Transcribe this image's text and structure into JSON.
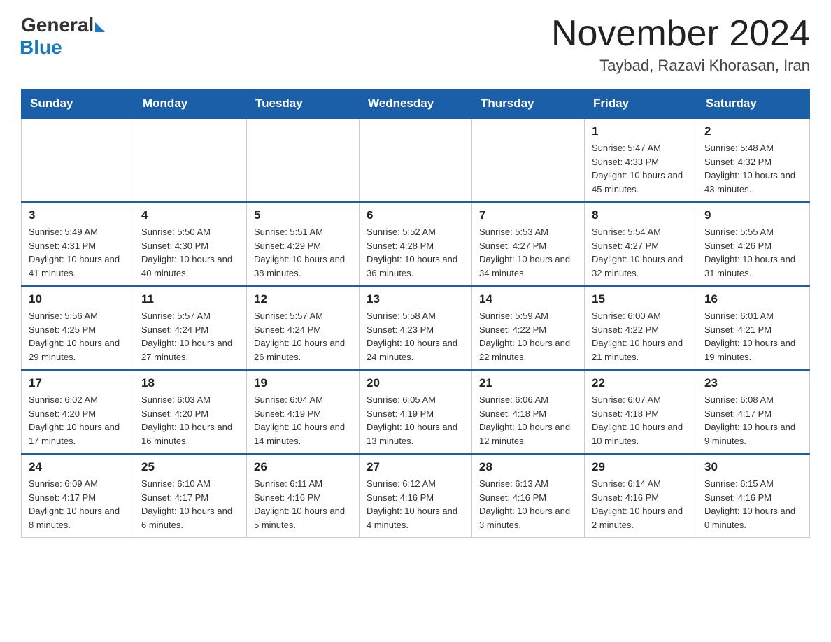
{
  "logo": {
    "general": "General",
    "blue": "Blue"
  },
  "title": "November 2024",
  "subtitle": "Taybad, Razavi Khorasan, Iran",
  "days_of_week": [
    "Sunday",
    "Monday",
    "Tuesday",
    "Wednesday",
    "Thursday",
    "Friday",
    "Saturday"
  ],
  "weeks": [
    [
      {
        "day": "",
        "info": ""
      },
      {
        "day": "",
        "info": ""
      },
      {
        "day": "",
        "info": ""
      },
      {
        "day": "",
        "info": ""
      },
      {
        "day": "",
        "info": ""
      },
      {
        "day": "1",
        "info": "Sunrise: 5:47 AM\nSunset: 4:33 PM\nDaylight: 10 hours and 45 minutes."
      },
      {
        "day": "2",
        "info": "Sunrise: 5:48 AM\nSunset: 4:32 PM\nDaylight: 10 hours and 43 minutes."
      }
    ],
    [
      {
        "day": "3",
        "info": "Sunrise: 5:49 AM\nSunset: 4:31 PM\nDaylight: 10 hours and 41 minutes."
      },
      {
        "day": "4",
        "info": "Sunrise: 5:50 AM\nSunset: 4:30 PM\nDaylight: 10 hours and 40 minutes."
      },
      {
        "day": "5",
        "info": "Sunrise: 5:51 AM\nSunset: 4:29 PM\nDaylight: 10 hours and 38 minutes."
      },
      {
        "day": "6",
        "info": "Sunrise: 5:52 AM\nSunset: 4:28 PM\nDaylight: 10 hours and 36 minutes."
      },
      {
        "day": "7",
        "info": "Sunrise: 5:53 AM\nSunset: 4:27 PM\nDaylight: 10 hours and 34 minutes."
      },
      {
        "day": "8",
        "info": "Sunrise: 5:54 AM\nSunset: 4:27 PM\nDaylight: 10 hours and 32 minutes."
      },
      {
        "day": "9",
        "info": "Sunrise: 5:55 AM\nSunset: 4:26 PM\nDaylight: 10 hours and 31 minutes."
      }
    ],
    [
      {
        "day": "10",
        "info": "Sunrise: 5:56 AM\nSunset: 4:25 PM\nDaylight: 10 hours and 29 minutes."
      },
      {
        "day": "11",
        "info": "Sunrise: 5:57 AM\nSunset: 4:24 PM\nDaylight: 10 hours and 27 minutes."
      },
      {
        "day": "12",
        "info": "Sunrise: 5:57 AM\nSunset: 4:24 PM\nDaylight: 10 hours and 26 minutes."
      },
      {
        "day": "13",
        "info": "Sunrise: 5:58 AM\nSunset: 4:23 PM\nDaylight: 10 hours and 24 minutes."
      },
      {
        "day": "14",
        "info": "Sunrise: 5:59 AM\nSunset: 4:22 PM\nDaylight: 10 hours and 22 minutes."
      },
      {
        "day": "15",
        "info": "Sunrise: 6:00 AM\nSunset: 4:22 PM\nDaylight: 10 hours and 21 minutes."
      },
      {
        "day": "16",
        "info": "Sunrise: 6:01 AM\nSunset: 4:21 PM\nDaylight: 10 hours and 19 minutes."
      }
    ],
    [
      {
        "day": "17",
        "info": "Sunrise: 6:02 AM\nSunset: 4:20 PM\nDaylight: 10 hours and 17 minutes."
      },
      {
        "day": "18",
        "info": "Sunrise: 6:03 AM\nSunset: 4:20 PM\nDaylight: 10 hours and 16 minutes."
      },
      {
        "day": "19",
        "info": "Sunrise: 6:04 AM\nSunset: 4:19 PM\nDaylight: 10 hours and 14 minutes."
      },
      {
        "day": "20",
        "info": "Sunrise: 6:05 AM\nSunset: 4:19 PM\nDaylight: 10 hours and 13 minutes."
      },
      {
        "day": "21",
        "info": "Sunrise: 6:06 AM\nSunset: 4:18 PM\nDaylight: 10 hours and 12 minutes."
      },
      {
        "day": "22",
        "info": "Sunrise: 6:07 AM\nSunset: 4:18 PM\nDaylight: 10 hours and 10 minutes."
      },
      {
        "day": "23",
        "info": "Sunrise: 6:08 AM\nSunset: 4:17 PM\nDaylight: 10 hours and 9 minutes."
      }
    ],
    [
      {
        "day": "24",
        "info": "Sunrise: 6:09 AM\nSunset: 4:17 PM\nDaylight: 10 hours and 8 minutes."
      },
      {
        "day": "25",
        "info": "Sunrise: 6:10 AM\nSunset: 4:17 PM\nDaylight: 10 hours and 6 minutes."
      },
      {
        "day": "26",
        "info": "Sunrise: 6:11 AM\nSunset: 4:16 PM\nDaylight: 10 hours and 5 minutes."
      },
      {
        "day": "27",
        "info": "Sunrise: 6:12 AM\nSunset: 4:16 PM\nDaylight: 10 hours and 4 minutes."
      },
      {
        "day": "28",
        "info": "Sunrise: 6:13 AM\nSunset: 4:16 PM\nDaylight: 10 hours and 3 minutes."
      },
      {
        "day": "29",
        "info": "Sunrise: 6:14 AM\nSunset: 4:16 PM\nDaylight: 10 hours and 2 minutes."
      },
      {
        "day": "30",
        "info": "Sunrise: 6:15 AM\nSunset: 4:16 PM\nDaylight: 10 hours and 0 minutes."
      }
    ]
  ]
}
